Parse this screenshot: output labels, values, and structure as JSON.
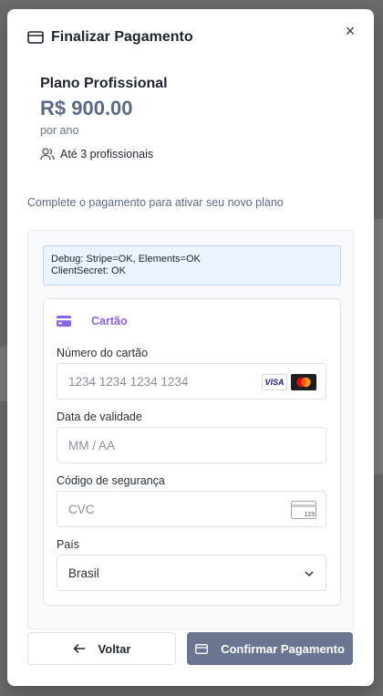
{
  "header": {
    "title": "Finalizar Pagamento",
    "close_label": "×"
  },
  "plan": {
    "name": "Plano Profissional",
    "price": "R$ 900.00",
    "period": "por ano",
    "users": "Até 3 profissionais"
  },
  "instruction": "Complete o pagamento para ativar seu novo plano",
  "debug": {
    "line1": "Debug: Stripe=OK, Elements=OK",
    "line2": "ClientSecret: OK"
  },
  "payment": {
    "method_label": "Cartão",
    "card_number": {
      "label": "Número do cartão",
      "placeholder": "1234 1234 1234 1234"
    },
    "brands": [
      "VISA",
      "mastercard"
    ],
    "expiry": {
      "label": "Data de validade",
      "placeholder": "MM / AA"
    },
    "cvc": {
      "label": "Código de segurança",
      "placeholder": "CVC",
      "icon_text": "123"
    },
    "country": {
      "label": "País",
      "value": "Brasil"
    }
  },
  "actions": {
    "back_label": "Voltar",
    "confirm_label": "Confirmar Pagamento"
  },
  "colors": {
    "accent": "#8a63e6",
    "primary_button": "#6a7691",
    "price": "#5b6a86",
    "debug_bg": "#eaf3fe"
  }
}
